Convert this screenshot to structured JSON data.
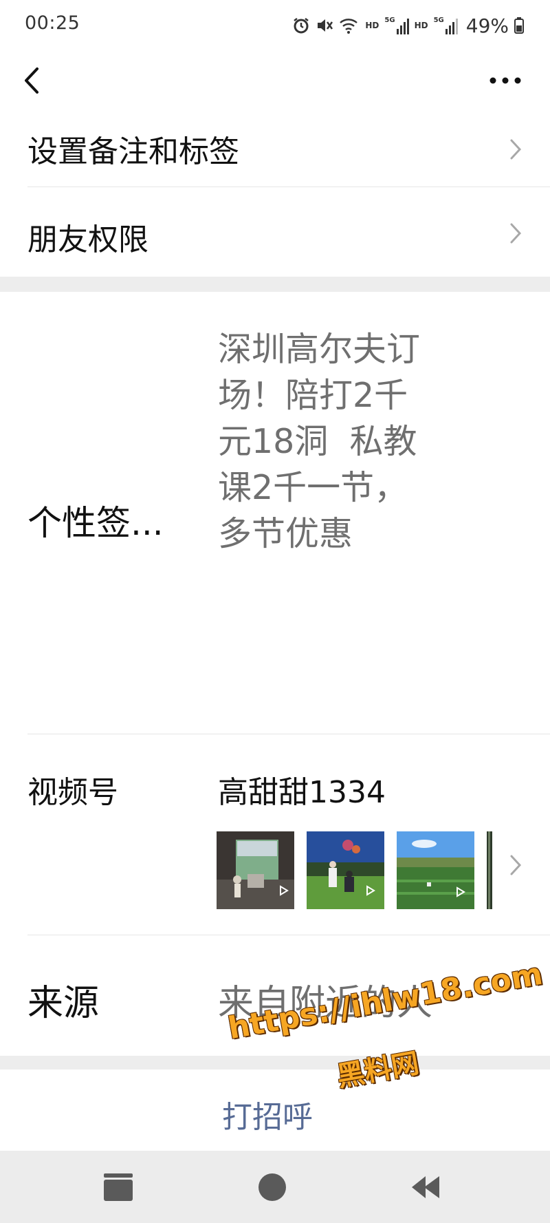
{
  "status_bar": {
    "time": "00:25",
    "hd1": "HD",
    "hd2": "HD",
    "net1": "5G",
    "net2": "5G",
    "battery": "49%"
  },
  "nav": {
    "back_icon": "chevron-left-icon",
    "more_icon": "ellipsis-icon"
  },
  "menu": {
    "remark_tags": "设置备注和标签",
    "friend_permissions": "朋友权限"
  },
  "signature": {
    "label": "个性签...",
    "lines": [
      "深圳高尔夫订",
      "场！陪打2千",
      "元18洞  私教",
      "课2千一节，",
      "多节优惠"
    ]
  },
  "channels": {
    "label": "视频号",
    "name": "高甜甜1334",
    "thumbnails": [
      "video-thumbnail-indoor-golf",
      "video-thumbnail-night-golf",
      "video-thumbnail-driving-range",
      "video-thumbnail-partial"
    ]
  },
  "source": {
    "label": "来源",
    "value": "来自附近的人"
  },
  "actions": {
    "greet": "打招呼"
  },
  "watermark": {
    "url": "https://ihlw18.com",
    "name": "黑料网"
  },
  "colors": {
    "link": "#576b95",
    "secondary_text": "#6f6f6f",
    "divider_band": "#ededed",
    "watermark": "#f6a623"
  }
}
